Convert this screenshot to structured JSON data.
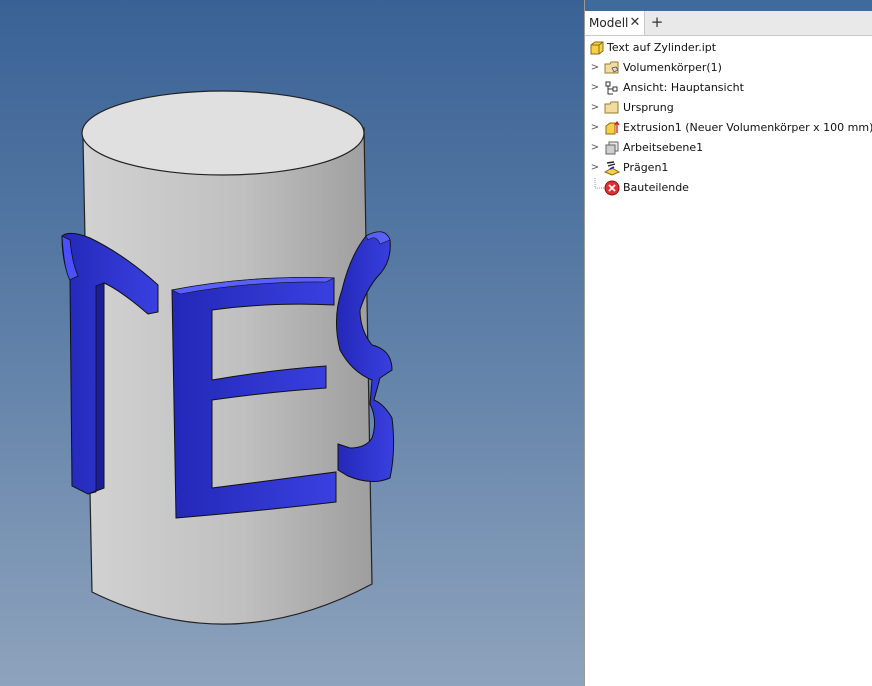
{
  "panel": {
    "tab_label": "Modell",
    "close_glyph": "✕",
    "add_glyph": "+"
  },
  "tree": {
    "root": {
      "label": "Text auf Zylinder.ipt",
      "icon": "part-file-icon"
    },
    "items": [
      {
        "label": "Volumenkörper(1)",
        "icon": "solid-bodies-folder-icon",
        "expandable": true
      },
      {
        "label": "Ansicht: Hauptansicht",
        "icon": "view-representation-icon",
        "expandable": true
      },
      {
        "label": "Ursprung",
        "icon": "origin-folder-icon",
        "expandable": true
      },
      {
        "label": "Extrusion1 (Neuer Volumenkörper x 100 mm)",
        "icon": "extrusion-icon",
        "expandable": true
      },
      {
        "label": "Arbeitsebene1",
        "icon": "work-plane-icon",
        "expandable": true
      },
      {
        "label": "Prägen1",
        "icon": "emboss-icon",
        "expandable": true
      },
      {
        "label": "Bauteilende",
        "icon": "end-of-part-icon",
        "expandable": false
      }
    ]
  },
  "colors": {
    "viewport_top": "#3a6296",
    "viewport_bottom": "#8ea3bd",
    "cylinder": "#c6c6c6",
    "emboss_text": "#2a2fd0"
  }
}
